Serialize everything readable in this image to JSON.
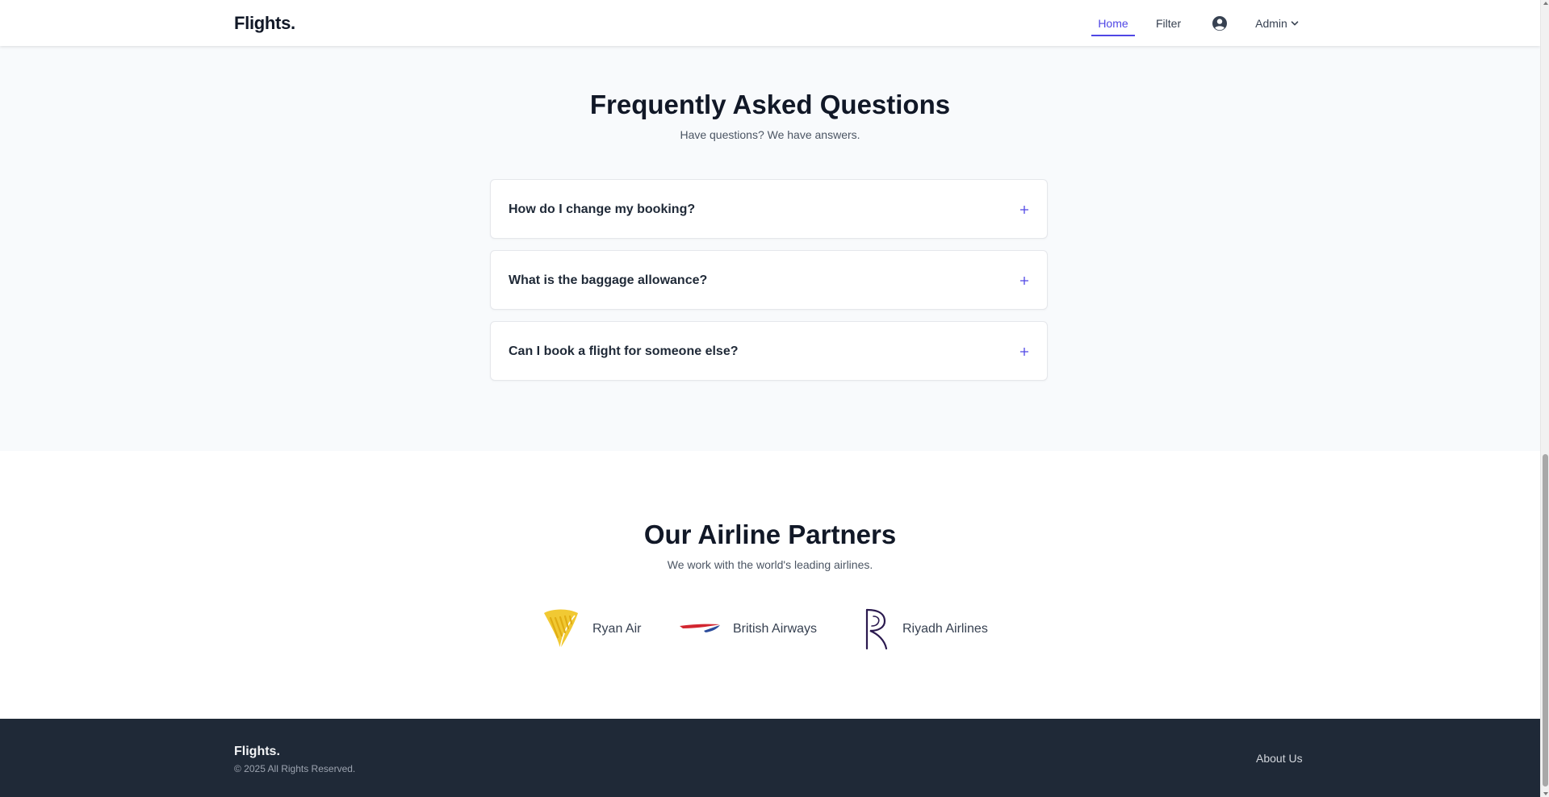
{
  "navbar": {
    "brand": "Flights.",
    "links": {
      "home": "Home",
      "filter": "Filter"
    },
    "user_menu": {
      "label": "Admin",
      "icon": "chevron-down-icon"
    },
    "account_icon": "user-circle-icon",
    "accent_color": "#4f46e5"
  },
  "faq": {
    "title": "Frequently Asked Questions",
    "subtitle": "Have questions? We have answers.",
    "items": [
      {
        "question": "How do I change my booking?",
        "icon": "plus-icon",
        "expanded": false
      },
      {
        "question": "What is the baggage allowance?",
        "icon": "plus-icon",
        "expanded": false
      },
      {
        "question": "Can I book a flight for someone else?",
        "icon": "plus-icon",
        "expanded": false
      }
    ]
  },
  "partners": {
    "title": "Our Airline Partners",
    "subtitle": "We work with the world's leading airlines.",
    "airlines": [
      {
        "name": "Ryan Air",
        "logo": "ryanair-harp-logo",
        "color": "#f1c933"
      },
      {
        "name": "British Airways",
        "logo": "british-airways-speedmarque-logo",
        "color": "#d22630"
      },
      {
        "name": "Riyadh Airlines",
        "logo": "riyadh-air-r-logo",
        "color": "#2b1a4f"
      }
    ]
  },
  "footer": {
    "brand": "Flights.",
    "copyright": "© 2025 All Rights Reserved.",
    "about_link": "About Us",
    "background": "#1f2937"
  }
}
